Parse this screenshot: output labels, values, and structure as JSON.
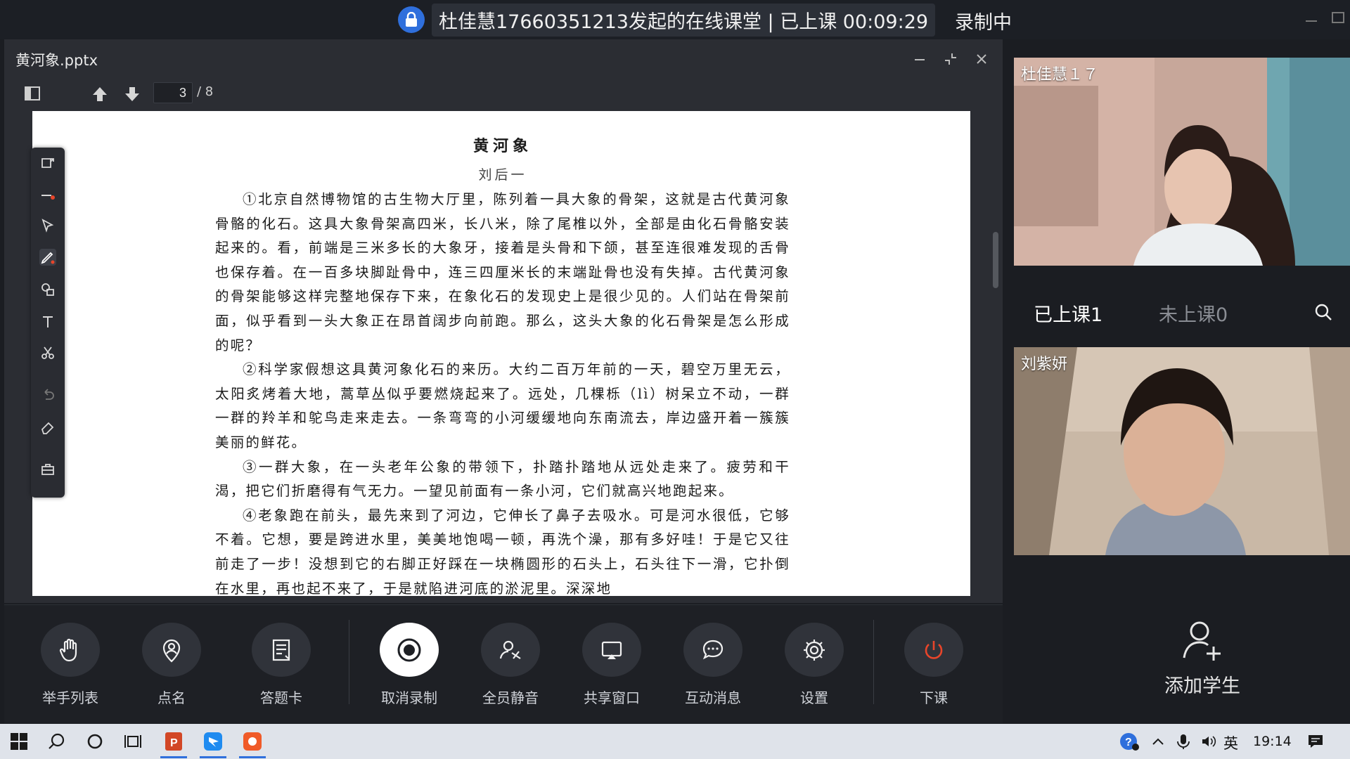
{
  "title_bar": {
    "session_title": "杜佳慧17660351213发起的在线课堂 | 已上课 00:09:29",
    "recording_status": "录制中"
  },
  "document": {
    "file_name": "黄河象.pptx",
    "page_current": "3",
    "page_total": "/ 8",
    "heading": "黄河象",
    "author": "刘后一",
    "paragraphs": [
      "①北京自然博物馆的古生物大厅里，陈列着一具大象的骨架，这就是古代黄河象骨骼的化石。这具大象骨架高四米，长八米，除了尾椎以外，全部是由化石骨骼安装起来的。看，前端是三米多长的大象牙，接着是头骨和下颌，甚至连很难发现的舌骨也保存着。在一百多块脚趾骨中，连三四厘米长的末端趾骨也没有失掉。古代黄河象的骨架能够这样完整地保存下来，在象化石的发现史上是很少见的。人们站在骨架前面，似乎看到一头大象正在昂首阔步向前跑。那么，这头大象的化石骨架是怎么形成的呢？",
      "②科学家假想这具黄河象化石的来历。大约二百万年前的一天，碧空万里无云，太阳炙烤着大地，蒿草丛似乎要燃烧起来了。远处，几棵栎（lì）树呆立不动，一群一群的羚羊和鸵鸟走来走去。一条弯弯的小河缓缓地向东南流去，岸边盛开着一簇簇美丽的鲜花。",
      "③一群大象，在一头老年公象的带领下，扑踏扑踏地从远处走来了。疲劳和干渴，把它们折磨得有气无力。一望见前面有一条小河，它们就高兴地跑起来。",
      "④老象跑在前头，最先来到了河边，它伸长了鼻子去吸水。可是河水很低，它够不着。它想，要是跨进水里，美美地饱喝一顿，再洗个澡，那有多好哇！于是它又往前走了一步！没想到它的右脚正好踩在一块椭圆形的石头上，石头往下一滑，它扑倒在水里，再也起不来了，于是就陷进河底的淤泥里。深深地"
    ]
  },
  "controls": [
    {
      "label": "举手列表",
      "icon": "raise-hand-icon"
    },
    {
      "label": "点名",
      "icon": "roll-call-icon"
    },
    {
      "label": "答题卡",
      "icon": "answer-card-icon"
    },
    {
      "label": "取消录制",
      "icon": "record-icon"
    },
    {
      "label": "全员静音",
      "icon": "mute-all-icon"
    },
    {
      "label": "共享窗口",
      "icon": "share-window-icon"
    },
    {
      "label": "互动消息",
      "icon": "chat-icon"
    },
    {
      "label": "设置",
      "icon": "settings-icon"
    },
    {
      "label": "下课",
      "icon": "power-icon"
    }
  ],
  "panel": {
    "teacher_name": "杜佳慧１７",
    "tab_attended": "已上课1",
    "tab_absent": "未上课0",
    "student_name": "刘紫妍",
    "add_student": "添加学生"
  },
  "taskbar": {
    "ime": "英",
    "clock": "19:14"
  },
  "colors": {
    "accent_blue": "#2f6fdc",
    "end_class_red": "#e8452a"
  }
}
